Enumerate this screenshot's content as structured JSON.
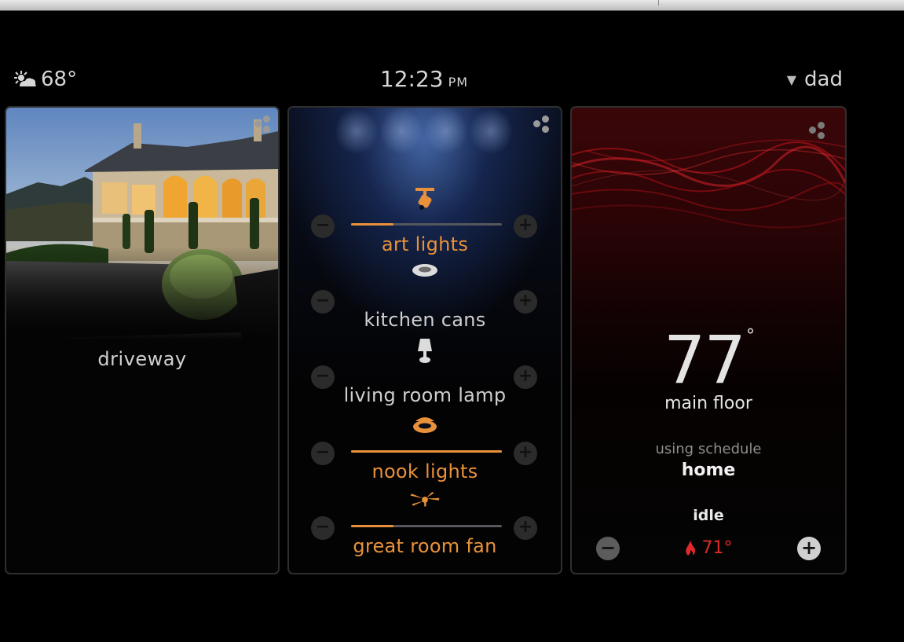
{
  "status_bar": {
    "weather_temp": "68°",
    "weather_icon": "partly-cloudy-icon",
    "time": "12:23",
    "ampm": "PM",
    "user": "dad"
  },
  "cards": {
    "camera": {
      "label": "driveway"
    },
    "lights": {
      "items": [
        {
          "name": "art lights",
          "icon": "spotlight-icon",
          "level": 0.28,
          "active": true
        },
        {
          "name": "kitchen cans",
          "icon": "recessed-light-icon",
          "level": null,
          "active": false
        },
        {
          "name": "living room lamp",
          "icon": "lamp-icon",
          "level": null,
          "active": false
        },
        {
          "name": "nook lights",
          "icon": "pendant-light-icon",
          "level": 1.0,
          "active": true
        },
        {
          "name": "great room fan",
          "icon": "ceiling-fan-icon",
          "level": 0.28,
          "active": true
        }
      ]
    },
    "thermostat": {
      "temperature": "77",
      "degree": "°",
      "zone": "main floor",
      "schedule_caption": "using schedule",
      "schedule": "home",
      "state": "idle",
      "setpoint": "71°",
      "minus": "−",
      "plus": "+"
    }
  },
  "colors": {
    "accent": "#e8913a",
    "heat": "#e02a2a",
    "background": "#000000"
  }
}
